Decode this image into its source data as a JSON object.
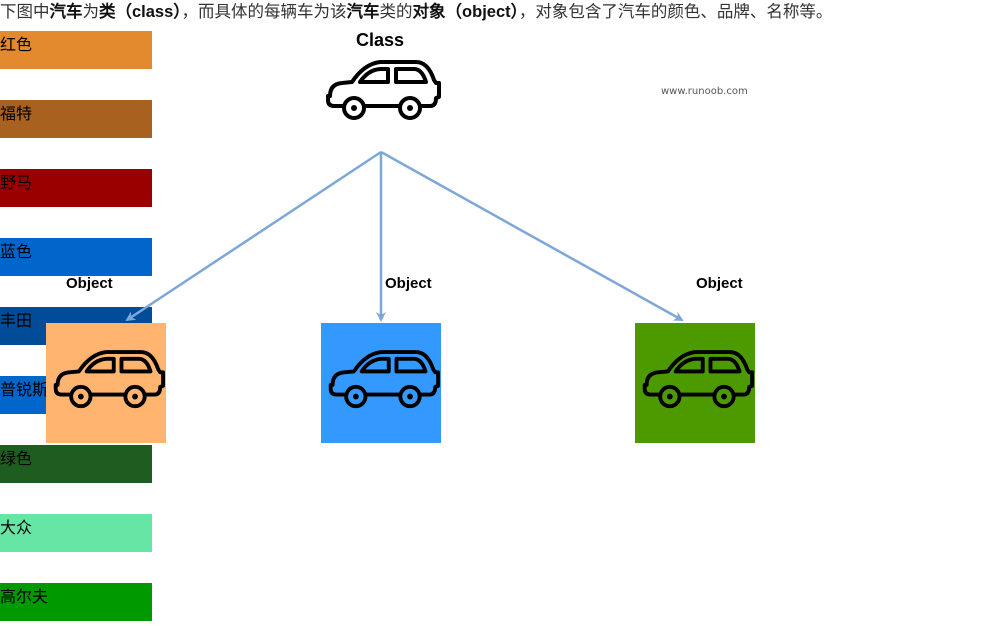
{
  "caption": {
    "parts": [
      {
        "text": "下图中",
        "bold": false
      },
      {
        "text": "汽车",
        "bold": true
      },
      {
        "text": "为",
        "bold": false
      },
      {
        "text": "类（class）",
        "bold": true
      },
      {
        "text": "，而具体的每辆车为该",
        "bold": false
      },
      {
        "text": "汽车",
        "bold": true
      },
      {
        "text": "类的",
        "bold": false
      },
      {
        "text": "对象（object）",
        "bold": true
      },
      {
        "text": "，对象包含了汽车的颜色、品牌、名称等。",
        "bold": false
      }
    ]
  },
  "diagram": {
    "class_label": "Class",
    "watermark": "www.runoob.com",
    "arrow_color": "#7da7d9",
    "objects": [
      {
        "label": "Object",
        "card_color": "#ffb570",
        "frame_color": "#e08a3a",
        "attributes": [
          {
            "text": "红色",
            "color": "#e38a2e"
          },
          {
            "text": "福特",
            "color": "#a8611f"
          },
          {
            "text": "野马",
            "color": "#9a0000"
          }
        ]
      },
      {
        "label": "Object",
        "card_color": "#3399ff",
        "frame_color": "#4a7fc0",
        "attributes": [
          {
            "text": "蓝色",
            "color": "#0066cc"
          },
          {
            "text": "丰田",
            "color": "#004c99"
          },
          {
            "text": "普锐斯",
            "color": "#0066cc"
          }
        ]
      },
      {
        "label": "Object",
        "card_color": "#4d9900",
        "frame_color": "#3a7a3a",
        "attributes": [
          {
            "text": "绿色",
            "color": "#1f5c1f"
          },
          {
            "text": "大众",
            "color": "#66e6a5"
          },
          {
            "text": "高尔夫",
            "color": "#009900"
          }
        ]
      }
    ]
  }
}
